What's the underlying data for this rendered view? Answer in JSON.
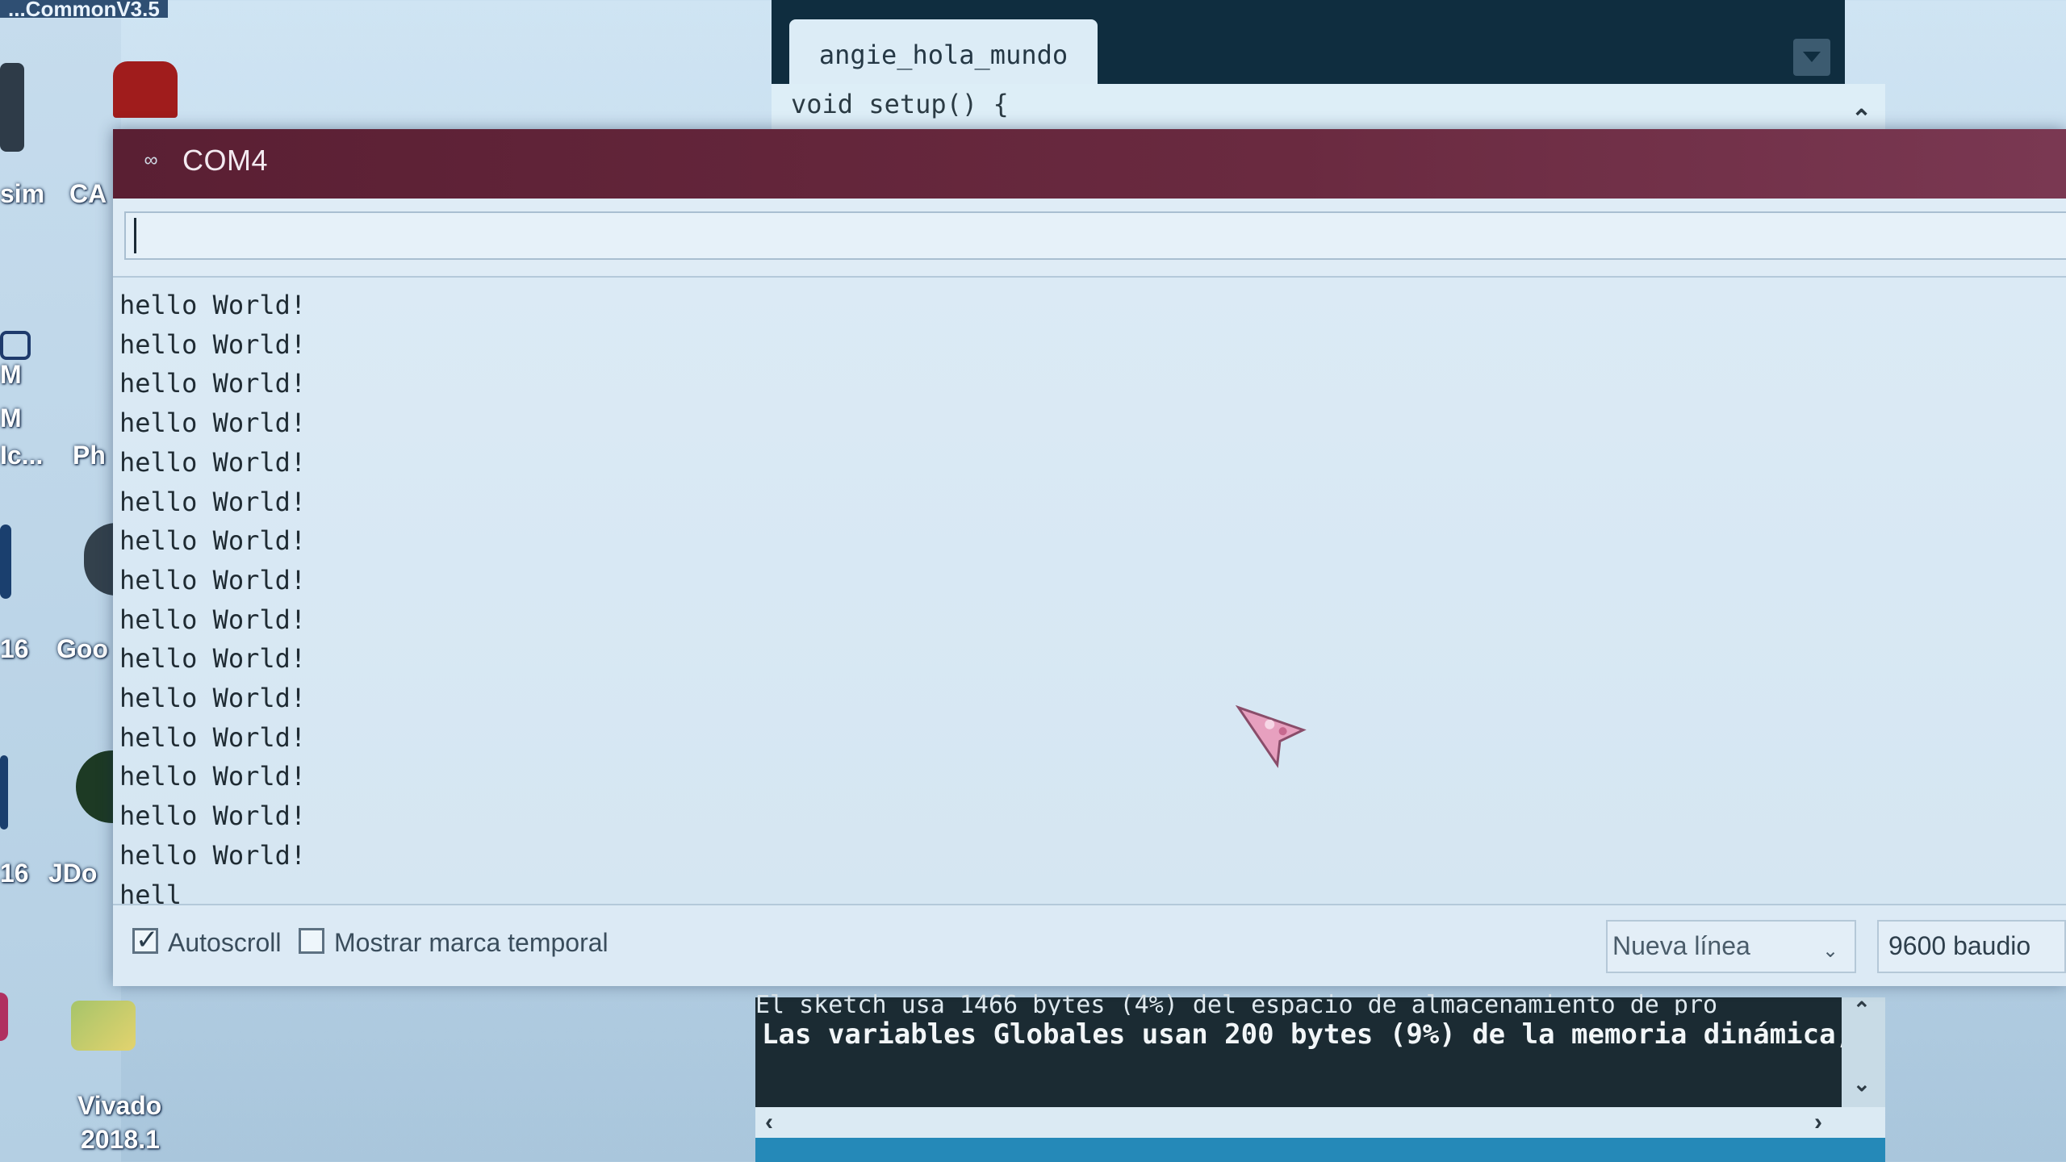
{
  "desktop": {
    "top_label": "...CommonV3.5",
    "icons": [
      "sim",
      "CA",
      "M",
      "M",
      "Ic...",
      "Ph",
      "16",
      "Goo",
      "16",
      "JDo",
      "Vivado",
      "2018.1"
    ]
  },
  "ide": {
    "tab_label": "angie_hola_mundo",
    "code_line": "void setup() {",
    "console_partial": "El sketch usa 1466 bytes (4%) del espacio de almacenamiento de pro",
    "console_line": "Las variables Globales usan 200 bytes (9%) de la memoria dinámica,"
  },
  "serial_monitor": {
    "title": "COM4",
    "send_value": "",
    "output": "hello World!\nhello World!\nhello World!\nhello World!\nhello World!\nhello World!\nhello World!\nhello World!\nhello World!\nhello World!\nhello World!\nhello World!\nhello World!\nhello World!\nhello World!\nhell",
    "autoscroll_label": "Autoscroll",
    "autoscroll_checked": true,
    "timestamp_label": "Mostrar marca temporal",
    "timestamp_checked": false,
    "line_ending": "Nueva línea",
    "baud_rate": "9600 baudio"
  },
  "colors": {
    "titlebar": "#5a1f33",
    "ide_dark": "#0f2d3f",
    "console_bg": "#1b2b33",
    "status_bar": "#2589b8"
  },
  "icons": {
    "title_icon": "arduino-infinity-icon",
    "cursor": "pointer-cursor-icon"
  }
}
